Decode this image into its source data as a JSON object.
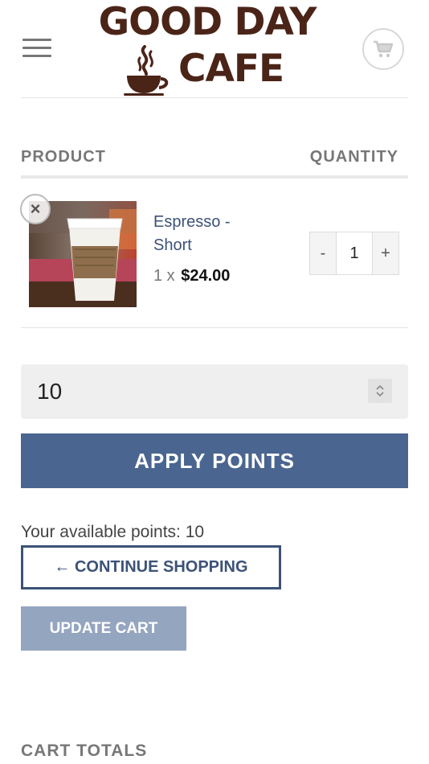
{
  "header": {
    "logo_line1": "GOOD DAY",
    "logo_line2": "CAFE",
    "brand_color": "#4b2418",
    "menu_icon": "hamburger-icon",
    "cart_icon": "cart-icon"
  },
  "table": {
    "product_header": "PRODUCT",
    "quantity_header": "QUANTITY"
  },
  "cart_items": [
    {
      "remove_symbol": "×",
      "name": "Espresso - Short",
      "qty_prefix": "1 x",
      "price": "$24.00",
      "quantity": "1",
      "minus_label": "-",
      "plus_label": "+",
      "image_icon": "coffee-cup-image"
    }
  ],
  "points": {
    "input_value": "10",
    "apply_label": "APPLY POINTS",
    "available_text": "Your available points: 10"
  },
  "actions": {
    "continue_label": "← CONTINUE SHOPPING",
    "update_label": "UPDATE CART"
  },
  "totals": {
    "title": "CART TOTALS"
  },
  "colors": {
    "accent": "#4a6690",
    "link": "#3c5278",
    "disabled_button": "#94a5bf"
  }
}
